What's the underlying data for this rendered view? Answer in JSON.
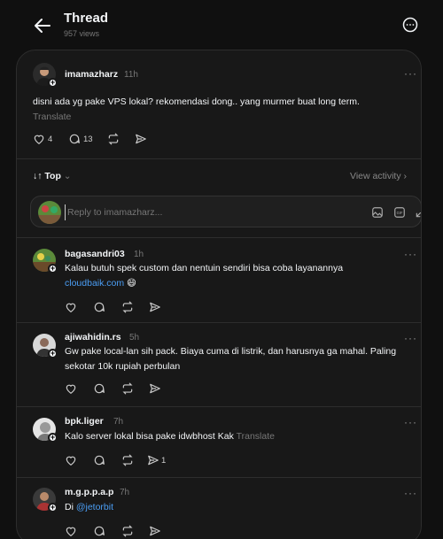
{
  "header": {
    "title": "Thread",
    "views": "957 views"
  },
  "main_post": {
    "username": "imamazharz",
    "time": "11h",
    "text": "disni ada yg pake VPS lokal? rekomendasi dong.. yang murmer buat long term.",
    "translate": "Translate",
    "likes": "4",
    "comments": "13"
  },
  "replies_bar": {
    "sort_label": "Top",
    "view_activity": "View activity"
  },
  "reply_box": {
    "placeholder": "Reply to imamazharz..."
  },
  "replies": [
    {
      "username": "bagasandri03",
      "time": "1h",
      "text": "Kalau butuh spek custom dan nentuin sendiri bisa coba layanannya",
      "link": "cloudbaik.com",
      "emoji": "😄"
    },
    {
      "username": "ajiwahidin.rs",
      "time": "5h",
      "text": "Gw pake local-lan sih pack. Biaya cuma di listrik, dan harusnya ga mahal. Paling sekotar 10k rupiah perbulan"
    },
    {
      "username": "bpk.liger",
      "time": "7h",
      "text": "Kalo server lokal bisa pake idwbhost Kak",
      "translate": "Translate",
      "shares": "1"
    },
    {
      "username": "m.g.p.p.a.p",
      "time": "7h",
      "text": "Di",
      "mention": "@jetorbit"
    }
  ],
  "colors": {
    "background": "#101010",
    "panel": "#181818",
    "link": "#4b9ef5",
    "muted": "#777777"
  }
}
